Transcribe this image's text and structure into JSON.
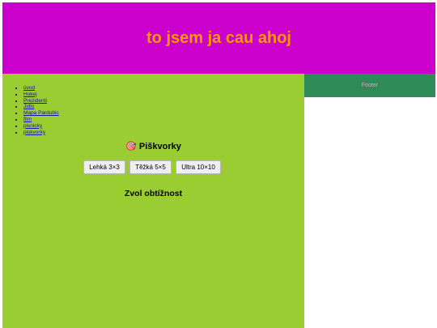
{
  "header": {
    "title": "to jsem ja cau ahoj"
  },
  "nav": {
    "items": [
      {
        "label": "úvod"
      },
      {
        "label": "Hokej"
      },
      {
        "label": "Prezidenti"
      },
      {
        "label": "Jidlo"
      },
      {
        "label": "Mapa Pardubic"
      },
      {
        "label": "film"
      },
      {
        "label": "pisnicky"
      },
      {
        "label": "piskvorky"
      }
    ]
  },
  "game": {
    "icon": "🎯",
    "icon_name": "target-icon",
    "title": "Piškvorky",
    "buttons": {
      "easy": "Lehká 3×3",
      "hard": "Těžká 5×5",
      "ultra": "Ultra 10×10"
    },
    "status": "Zvol obtížnost"
  },
  "footer": {
    "text": "Footer"
  },
  "colors": {
    "header_bg": "#cc00cc",
    "header_text": "#ff9900",
    "main_bg": "#9acd32",
    "footer_bg": "#2e8b57",
    "footer_text": "#ff8fd2",
    "link": "#1a0dab"
  }
}
